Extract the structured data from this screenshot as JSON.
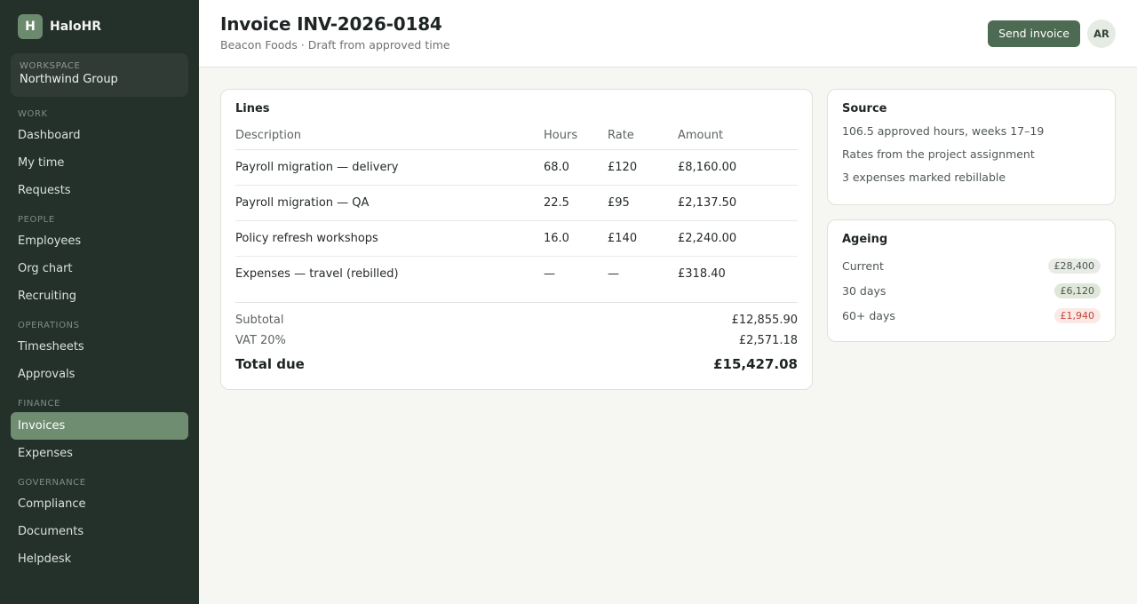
{
  "brand": {
    "logo_letter": "H",
    "name": "HaloHR"
  },
  "workspace": {
    "label": "WORKSPACE",
    "name": "Northwind Group"
  },
  "nav": {
    "work": {
      "label": "WORK",
      "items": [
        "Dashboard",
        "My time",
        "Requests"
      ]
    },
    "people": {
      "label": "PEOPLE",
      "items": [
        "Employees",
        "Org chart",
        "Recruiting"
      ]
    },
    "operations": {
      "label": "OPERATIONS",
      "items": [
        "Timesheets",
        "Approvals"
      ]
    },
    "finance": {
      "label": "FINANCE",
      "items": [
        "Invoices",
        "Expenses"
      ],
      "active": "Invoices"
    },
    "governance": {
      "label": "GOVERNANCE",
      "items": [
        "Compliance",
        "Documents",
        "Helpdesk"
      ]
    }
  },
  "header": {
    "title": "Invoice INV-2026-0184",
    "subtitle": "Beacon Foods · Draft from approved time",
    "send_label": "Send invoice",
    "avatar_initials": "AR"
  },
  "lines": {
    "title": "Lines",
    "columns": [
      "Description",
      "Hours",
      "Rate",
      "Amount"
    ],
    "rows": [
      [
        "Payroll migration — delivery",
        "68.0",
        "£120",
        "£8,160.00"
      ],
      [
        "Payroll migration — QA",
        "22.5",
        "£95",
        "£2,137.50"
      ],
      [
        "Policy refresh workshops",
        "16.0",
        "£140",
        "£2,240.00"
      ],
      [
        "Expenses — travel (rebilled)",
        "—",
        "—",
        "£318.40"
      ]
    ],
    "subtotal_label": "Subtotal",
    "subtotal": "£12,855.90",
    "vat_label": "VAT 20%",
    "vat": "£2,571.18",
    "total_label": "Total due",
    "total": "£15,427.08"
  },
  "source": {
    "title": "Source",
    "lines": [
      "106.5 approved hours, weeks 17–19",
      "Rates from the project assignment",
      "3 expenses marked rebillable"
    ]
  },
  "ageing": {
    "title": "Ageing",
    "rows": [
      {
        "label": "Current",
        "value": "£28,400",
        "status": "neutral"
      },
      {
        "label": "30 days",
        "value": "£6,120",
        "status": "warn"
      },
      {
        "label": "60+ days",
        "value": "£1,940",
        "status": "danger"
      }
    ]
  },
  "colors": {
    "sidebar": "#24302a",
    "accent": "#4d6a52",
    "active_nav": "#6f8d71",
    "danger": "#c0463a"
  }
}
